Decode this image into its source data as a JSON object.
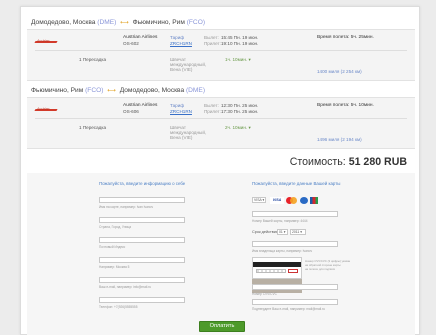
{
  "flights": [
    {
      "route": {
        "from": "Домодедово, Москва",
        "from_code": "(DME)",
        "to": "Фьюмичино, Рим",
        "to_code": "(FCO)"
      },
      "airline": "Austrian Airlines",
      "flight": "OS-602",
      "tariff_label": "Тариф",
      "tariff_code": "ZRCH1RN",
      "depart_label": "Вылет:",
      "depart_value": "15:45 Пн. 19 июн.",
      "arrive_label": "Прилет:",
      "arrive_value": "19:10 Пн. 19 июн.",
      "duration": "Время полета: 5ч. 25мин.",
      "transfers": "1 Пересадка",
      "airport_lines": [
        "Швечат",
        "международный,",
        "Вена (VIE)"
      ],
      "wait": "1ч. 10мин.",
      "distance": "1400 миля (2 254 км)"
    },
    {
      "route": {
        "from": "Фьюмичино, Рим",
        "from_code": "(FCO)",
        "to": "Домодедово, Москва",
        "to_code": "(DME)"
      },
      "airline": "Austrian Airlines",
      "flight": "OS-606",
      "tariff_label": "Тариф",
      "tariff_code": "ZRCH1RN",
      "depart_label": "Вылет:",
      "depart_value": "12:30 Пн. 25 июн.",
      "arrive_label": "Прилет:",
      "arrive_value": "17:30 Пн. 25 июн.",
      "duration": "Время полета: 5ч. 10мин.",
      "transfers": "1 Пересадка",
      "airport_lines": [
        "Швечат",
        "международный,",
        "Вена (VIE)"
      ],
      "wait": "2ч. 10мин.",
      "distance": "1496 миля (2 194 км)"
    }
  ],
  "logo_text": "Austrian",
  "total": {
    "label": "Стоимость:",
    "value": "51 280 RUB"
  },
  "form": {
    "left_title": "Пожалуйста, введите информацию о себе",
    "right_title": "Пожалуйста, введите данные Вашей карты",
    "left_hints": [
      "Имя на карте, например: Ivan Ivanov",
      "Страна, Город, Улица",
      "Почтовый Индекс",
      "Например: Москва 5",
      "Ваш e-mail, например: info@mail.ru",
      "Телефон: +7(926)5555555"
    ],
    "card_type": "VISA",
    "card_hints": [
      "Номер Вашей карты, например: 4444",
      "Срок действия:",
      "Имя владельца карты, например: Ivanov",
      "Номер CVV/CVC",
      "Подтвердите Ваш e-mail, например: mail@mail.ru"
    ],
    "expiry_label": "Срок действия:",
    "expiry_month": "01",
    "expiry_year": "2011",
    "card_notes": [
      "Номер CVV/CVC (3 цифры) указан",
      "на обратной стороне карты",
      "на полосе для подписи"
    ],
    "pay_button": "Оплатить"
  }
}
